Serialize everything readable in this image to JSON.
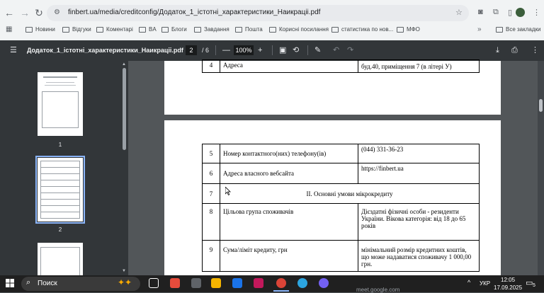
{
  "browser": {
    "url": "finbert.ua/media/creditconfig/Додаток_1_істотні_характеристики_Наикраціі.pdf",
    "bookmarks": [
      "Новини",
      "Відгуки",
      "Коментарі",
      "BA",
      "Блоги",
      "Завдання",
      "Пошта",
      "Корисні посилання",
      "статистика по нов...",
      "МФО"
    ],
    "all_bookmarks": "Все закладки"
  },
  "pdf": {
    "title": "Додаток_1_істотні_характеристики_Наикраціі.pdf",
    "current_page": "2",
    "total_pages": "/ 6",
    "zoom": "100%",
    "thumbnails": [
      "1",
      "2"
    ]
  },
  "document": {
    "top_row": {
      "num": "4",
      "label": "Адреса",
      "value": "буд.40, приміщення 7 (в літері У)"
    },
    "rows": [
      {
        "num": "5",
        "label": "Номер контактного(них) телефону(ів)",
        "value": "(044) 331-36-23"
      },
      {
        "num": "6",
        "label": "Адреса власного вебсайта",
        "value": "https://finbert.ua"
      },
      {
        "num": "7",
        "section": "II. Основні умови мікрокредиту"
      },
      {
        "num": "8",
        "label": "Цільова група споживачів",
        "value": "Дієздатні фізичні особи - резиденти України. Вікова категорія: від 18 до 65 років"
      },
      {
        "num": "9",
        "label": "Сума/ліміт кредиту, грн",
        "value": "мінімальний розмір кредитних коштів, що може надаватися споживачу 1 000,00 грн."
      }
    ]
  },
  "taskbar": {
    "search_placeholder": "Поиск",
    "time": "12:05",
    "date": "17.09.2025",
    "lang": "УКР",
    "notification_count": "5",
    "tray_hint": "meet.google.com"
  }
}
